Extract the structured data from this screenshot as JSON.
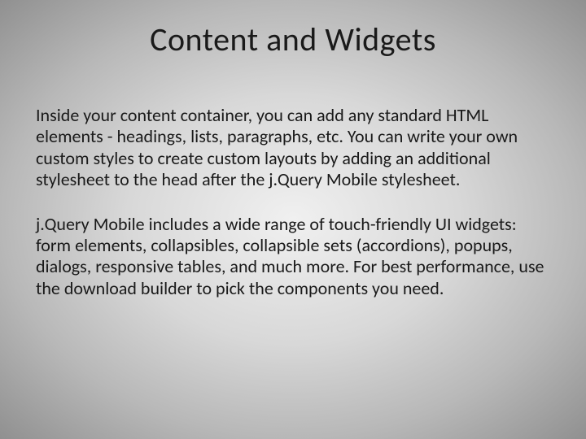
{
  "slide": {
    "title": "Content and Widgets",
    "paragraphs": [
      "Inside your content container, you can add any standard HTML elements - headings, lists, paragraphs, etc. You can write your own custom styles to create custom layouts by adding an additional stylesheet to the head after the j.Query Mobile stylesheet.",
      "j.Query Mobile includes a wide range of touch-friendly UI widgets: form elements, collapsibles, collapsible sets (accordions), popups, dialogs, responsive tables, and much more. For best performance, use the download builder to pick the components you need."
    ]
  }
}
